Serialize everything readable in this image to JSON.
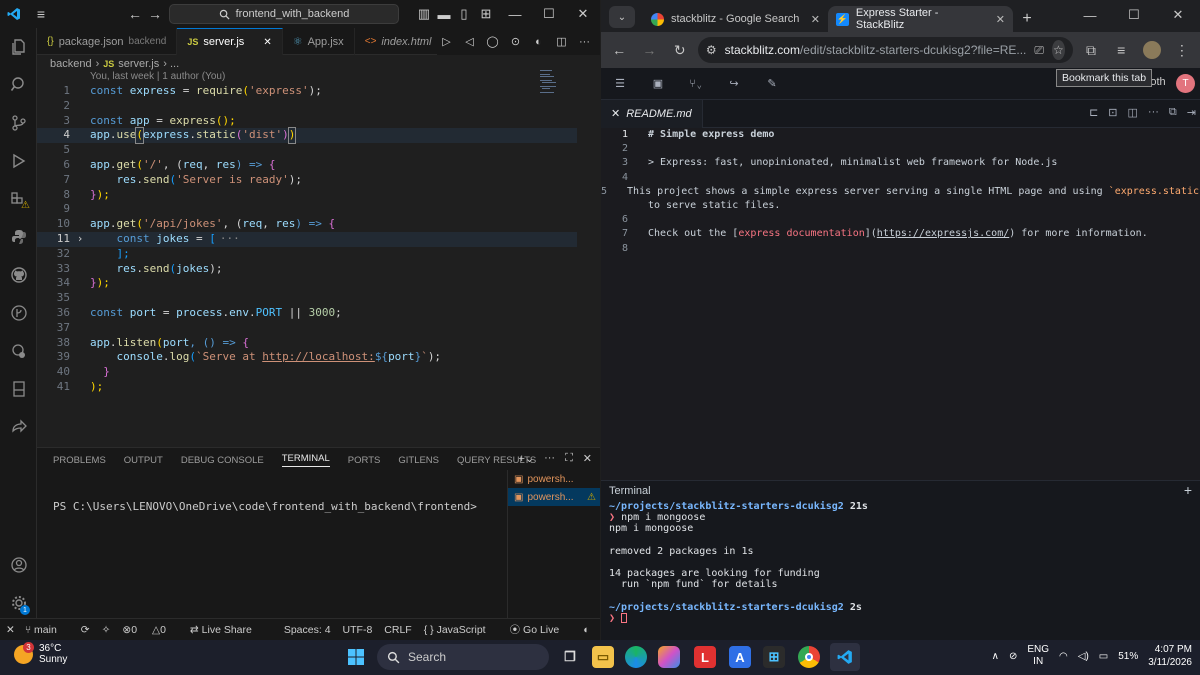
{
  "vscode": {
    "search": "frontend_with_backend",
    "tabs": [
      {
        "label": "package.json",
        "desc": "backend",
        "icon": "{}"
      },
      {
        "label": "server.js",
        "icon": "JS",
        "close": "✕"
      },
      {
        "label": "App.jsx",
        "icon": "⚛"
      },
      {
        "label": "index.html",
        "icon": "<>"
      }
    ],
    "breadcrumb": {
      "folder": "backend",
      "sep": "›",
      "js": "JS",
      "file": "server.js",
      "more": "› ..."
    },
    "blame": "You, last week | 1 author (You)",
    "line_numbers": [
      "1",
      "2",
      "3",
      "4",
      "5",
      "6",
      "7",
      "8",
      "9",
      "10",
      "11",
      "32",
      "33",
      "34",
      "35",
      "36",
      "37",
      "38",
      "39",
      "40",
      "41"
    ],
    "code": {
      "l1": [
        "const",
        " express ",
        "=",
        " require",
        "(",
        "'express'",
        ");"
      ],
      "l3": [
        "const",
        " app ",
        "=",
        " express",
        "();"
      ],
      "l4": [
        "app",
        ".",
        "use",
        "(",
        "express",
        ".",
        "static",
        "(",
        "'dist'",
        ")",
        ")"
      ],
      "l6": [
        "app",
        ".",
        "get",
        "(",
        "'/'",
        ", (",
        "req",
        ", ",
        "res",
        ") => ",
        "{"
      ],
      "l7": [
        "    res",
        ".",
        "send",
        "(",
        "'Server is ready'",
        ");"
      ],
      "l8": [
        "}",
        ");"
      ],
      "l10": [
        "app",
        ".",
        "get",
        "(",
        "'/api/jokes'",
        ", (",
        "req",
        ", ",
        "res",
        ") => ",
        "{"
      ],
      "l11": [
        "    const",
        " jokes ",
        "=",
        " [",
        "···"
      ],
      "l32": [
        "    ];"
      ],
      "l33": [
        "    res",
        ".",
        "send",
        "(",
        "jokes",
        ");"
      ],
      "l34": [
        "}",
        ");"
      ],
      "l36": [
        "const",
        " port ",
        "=",
        " process",
        ".",
        "env",
        ".",
        "PORT",
        " || ",
        "3000",
        ";"
      ],
      "l38": [
        "app",
        ".",
        "listen",
        "(",
        "port",
        ", () => ",
        "{"
      ],
      "l39": [
        "    console",
        ".",
        "log",
        "(",
        "`Serve at ",
        "http://localhost:",
        "${",
        "port",
        "}",
        "`",
        ");"
      ],
      "l40": [
        "  }"
      ],
      "l41": [
        ");"
      ]
    },
    "panel_tabs": [
      "PROBLEMS",
      "OUTPUT",
      "DEBUG CONSOLE",
      "TERMINAL",
      "PORTS",
      "GITLENS",
      "QUERY RESULTS"
    ],
    "terminal_prompt": "PS C:\\Users\\LENOVO\\OneDrive\\code\\frontend_with_backend\\frontend>",
    "terminals": [
      "powersh...",
      "powersh..."
    ],
    "status": {
      "branch": "main",
      "errors": "0",
      "warnings": "0",
      "liveshare": "Live Share",
      "spaces": "Spaces: 4",
      "encoding": "UTF-8",
      "eol": "CRLF",
      "lang": "JavaScript",
      "golive": "Go Live"
    }
  },
  "chrome": {
    "tabs": [
      {
        "label": "stackblitz - Google Search"
      },
      {
        "label": "Express Starter - StackBlitz"
      }
    ],
    "url_main": "stackblitz.com",
    "url_rest": "/edit/stackblitz-starters-dcukisg2?file=RE...",
    "tooltip": "Bookmark this tab",
    "both": "Both",
    "avatar": "T",
    "file_tab": "README.md",
    "readme": [
      {
        "n": "1",
        "parts": [
          "# Simple express demo"
        ]
      },
      {
        "n": "2",
        "parts": [
          ""
        ]
      },
      {
        "n": "3",
        "parts": [
          "> Express: fast, unopinionated, minimalist web framework for Node.js"
        ]
      },
      {
        "n": "4",
        "parts": [
          ""
        ]
      },
      {
        "n": "5",
        "parts": [
          "This project shows a simple express server serving a single HTML page and using ",
          "`express.static`"
        ]
      },
      {
        "n": "",
        "parts": [
          "to serve static files."
        ]
      },
      {
        "n": "6",
        "parts": [
          ""
        ]
      },
      {
        "n": "7",
        "parts": [
          "Check out the [",
          "express documentation",
          "](",
          "https://expressjs.com/",
          ") for more information."
        ]
      },
      {
        "n": "8",
        "parts": [
          ""
        ]
      }
    ],
    "terminal_title": "Terminal",
    "term": {
      "path1": "~/projects/stackblitz-starters-dcukisg2",
      "time1": "21s",
      "cmd": "npm i mongoose",
      "echo": "npm i mongoose",
      "removed": "removed 2 packages in 1s",
      "funding": "14 packages are looking for funding",
      "fund": "  run `npm fund` for details",
      "path2": "~/projects/stackblitz-starters-dcukisg2",
      "time2": "2s",
      "prompt": "❯"
    }
  },
  "taskbar": {
    "temp": "36°C",
    "weather": "Sunny",
    "badge": "3",
    "search": "Search",
    "lang1": "ENG",
    "lang2": "IN",
    "battery": "51%",
    "time": "4:07 PM",
    "date": "3/11/2026"
  }
}
